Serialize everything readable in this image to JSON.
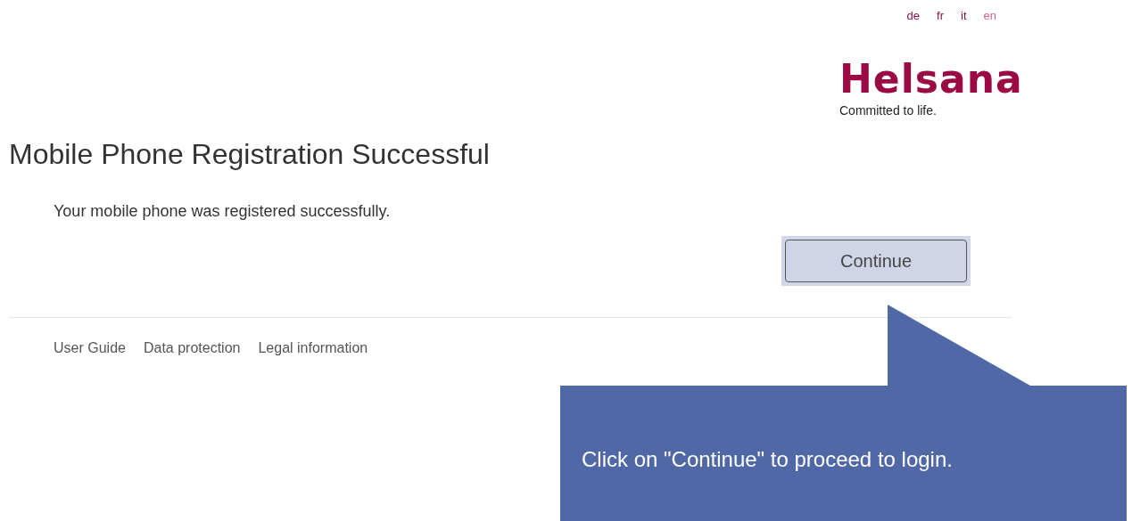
{
  "languages": [
    {
      "label": "de",
      "selected": false
    },
    {
      "label": "fr",
      "selected": false
    },
    {
      "label": "it",
      "selected": false
    },
    {
      "label": "en",
      "selected": true
    }
  ],
  "logo": {
    "name": "Helsana",
    "tagline": "Committed to life."
  },
  "title": "Mobile Phone Registration Successful",
  "message": "Your mobile phone was registered successfully.",
  "button": "Continue",
  "footer_links": [
    "User Guide",
    "Data protection",
    "Legal information"
  ],
  "callout": {
    "text": "Click on \"Continue\" to proceed to login."
  }
}
